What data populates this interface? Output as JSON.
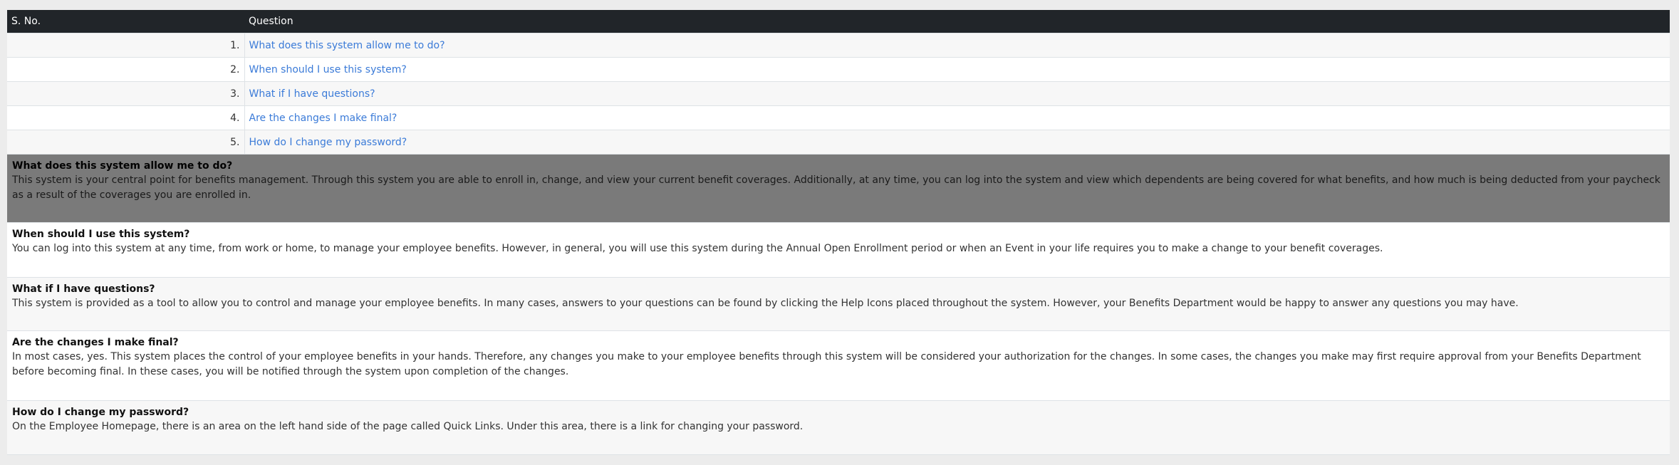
{
  "table": {
    "headers": {
      "num": "S. No.",
      "question": "Question"
    },
    "rows": [
      {
        "num": "1.",
        "question": "What does this system allow me to do?"
      },
      {
        "num": "2.",
        "question": "When should I use this system?"
      },
      {
        "num": "3.",
        "question": "What if I have questions?"
      },
      {
        "num": "4.",
        "question": "Are the changes I make final?"
      },
      {
        "num": "5.",
        "question": "How do I change my password?"
      }
    ]
  },
  "answers": [
    {
      "title": "What does this system allow me to do?",
      "body": "This system is your central point for benefits management. Through this system you are able to enroll in, change, and view your current benefit coverages. Additionally, at any time, you can log into the system and view which dependents are being covered for what benefits, and how much is being deducted from your paycheck as a result of the coverages you are enrolled in."
    },
    {
      "title": "When should I use this system?",
      "body": "You can log into this system at any time, from work or home, to manage your employee benefits. However, in general, you will use this system during the Annual Open Enrollment period or when an Event in your life requires you to make a change to your benefit coverages."
    },
    {
      "title": "What if I have questions?",
      "body": "This system is provided as a tool to allow you to control and manage your employee benefits. In many cases, answers to your questions can be found by clicking the Help Icons placed throughout the system. However, your Benefits Department would be happy to answer any questions you may have."
    },
    {
      "title": "Are the changes I make final?",
      "body": "In most cases, yes. This system places the control of your employee benefits in your hands. Therefore, any changes you make to your employee benefits through this system will be considered your authorization for the changes. In some cases, the changes you make may first require approval from your Benefits Department before becoming final. In these cases, you will be notified through the system upon completion of the changes."
    },
    {
      "title": "How do I change my password?",
      "body": "On the Employee Homepage, there is an area on the left hand side of the page called Quick Links. Under this area, there is a link for changing your password."
    }
  ],
  "colors": {
    "header_bg": "#212529",
    "link": "#3b7bd8",
    "highlight_bg": "#7a7a7a"
  }
}
